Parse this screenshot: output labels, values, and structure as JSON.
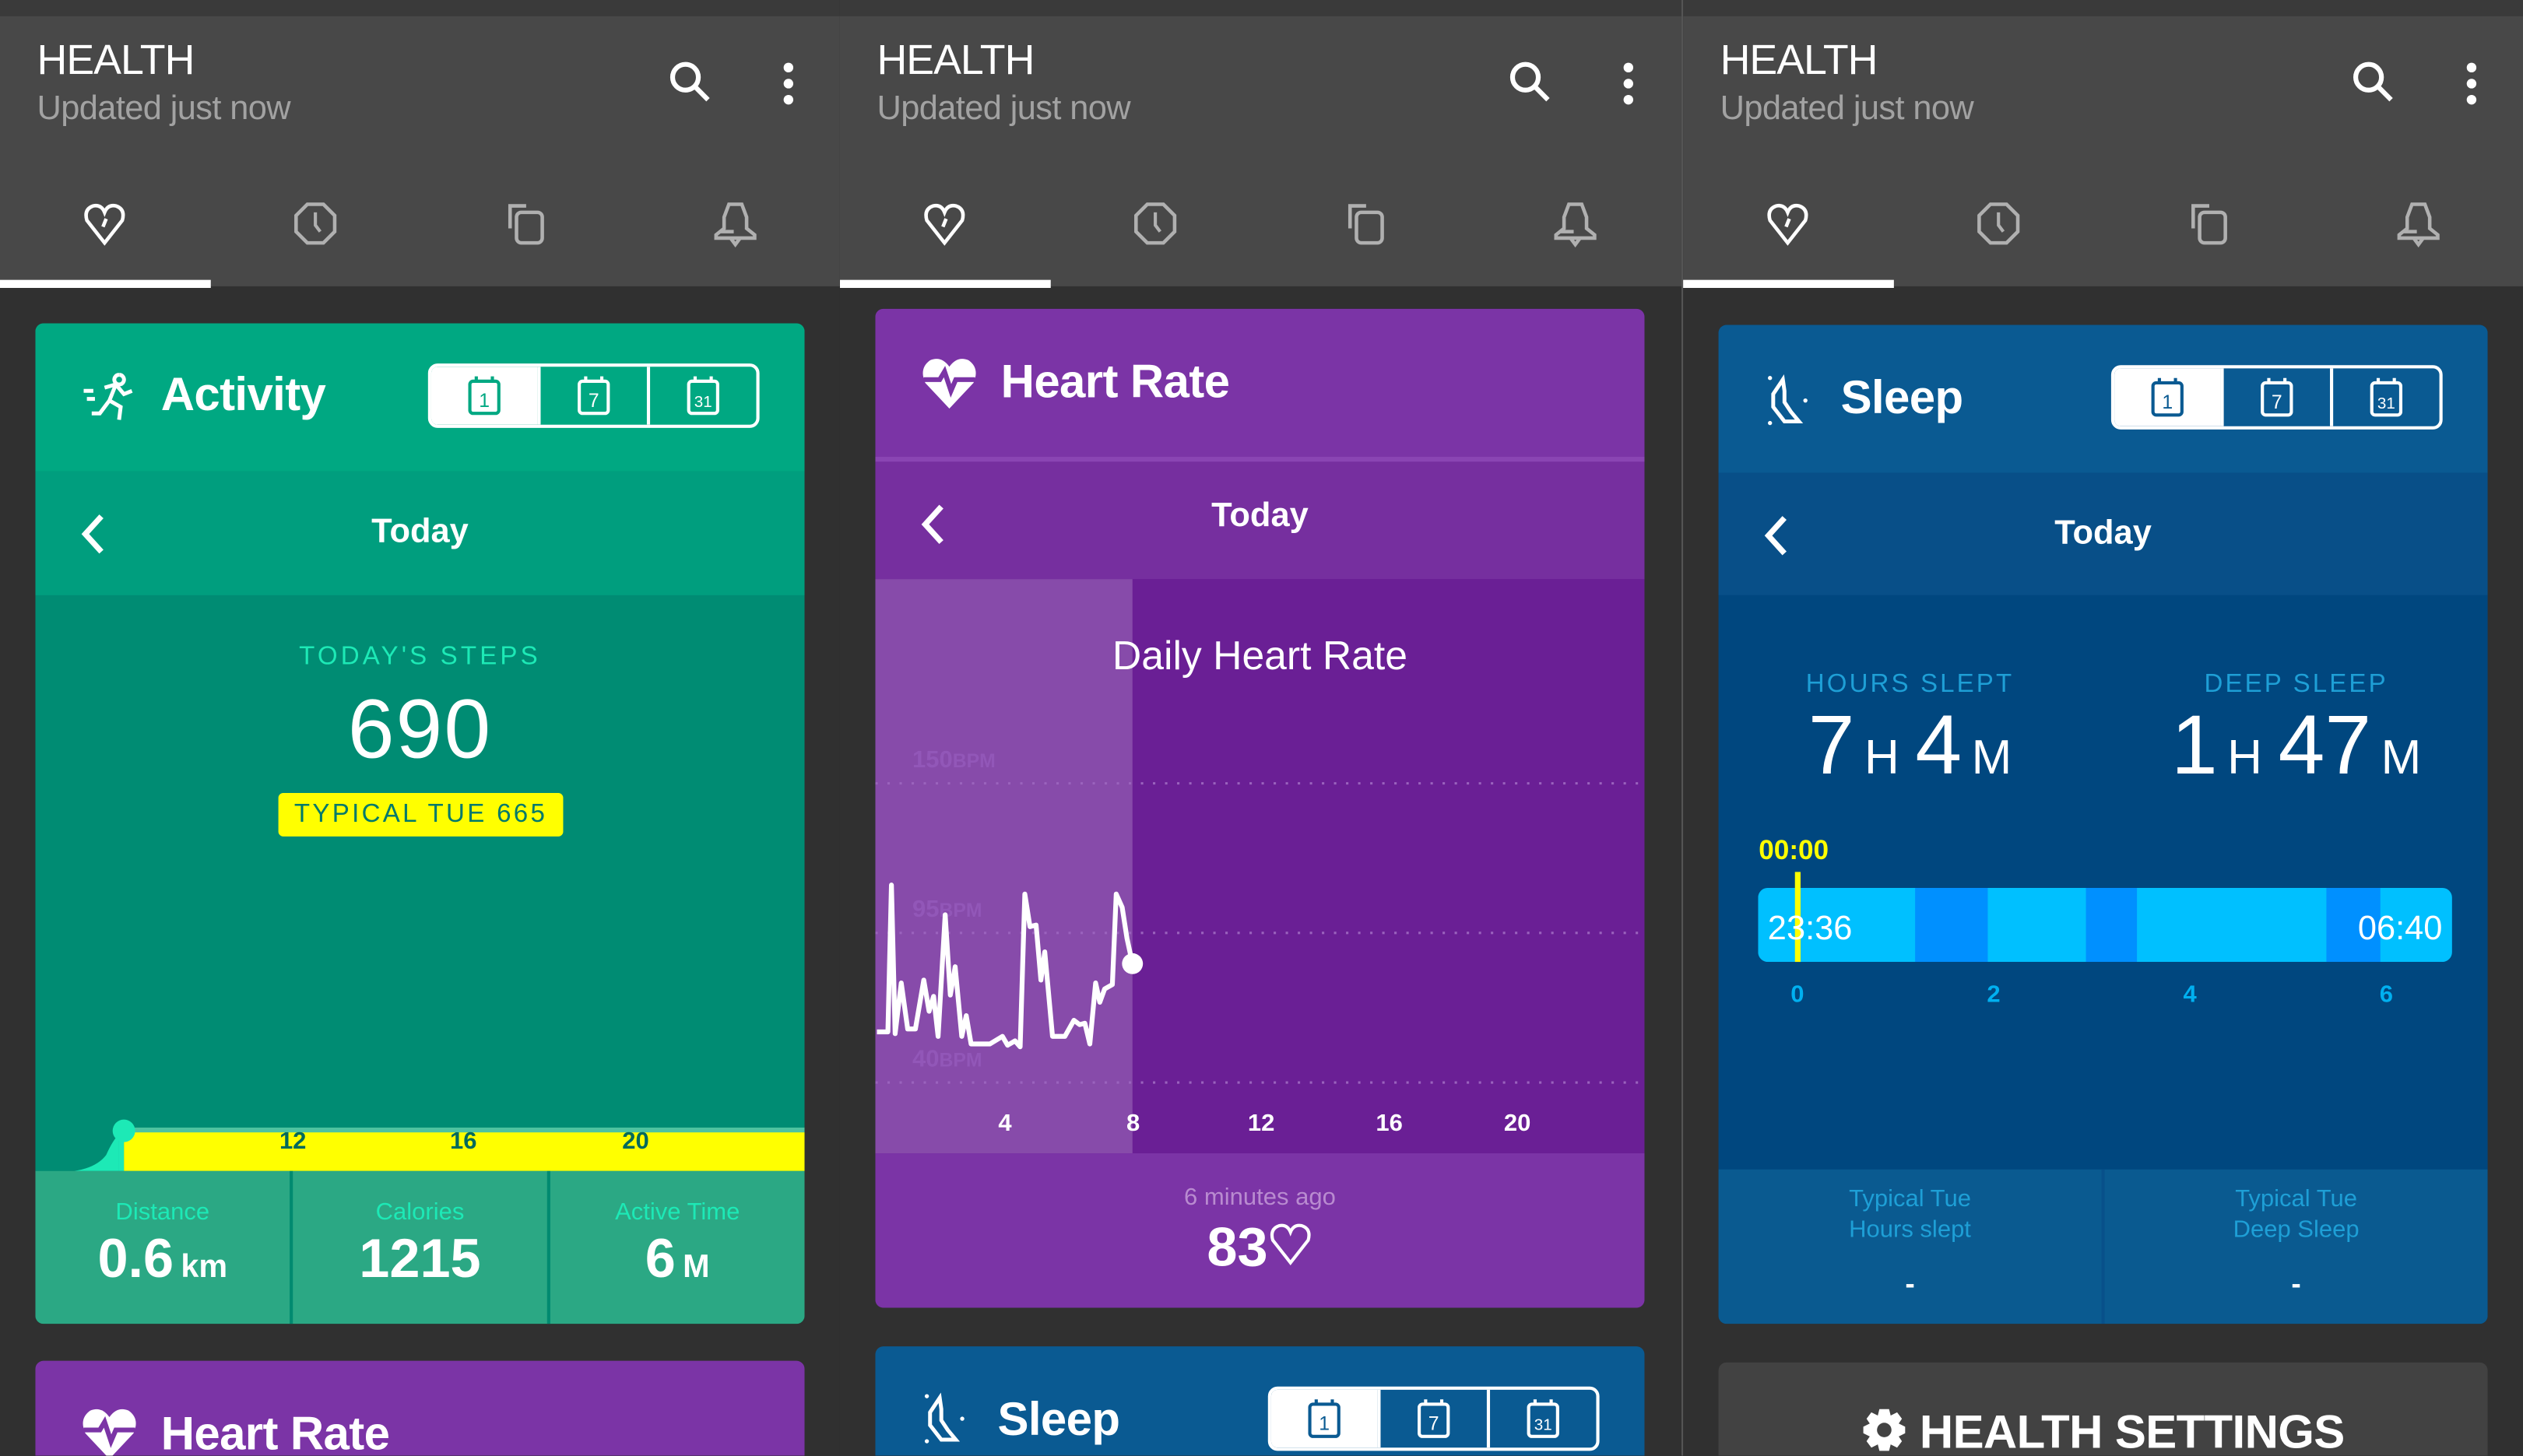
{
  "app": {
    "title": "HEALTH",
    "subtitle": "Updated just now"
  },
  "tabs": [
    {
      "icon": "heart-icon",
      "selected": true
    },
    {
      "icon": "clock-icon",
      "selected": false
    },
    {
      "icon": "copy-icon",
      "selected": false
    },
    {
      "icon": "bell-icon",
      "selected": false
    }
  ],
  "range_toggle": [
    "1",
    "7",
    "31"
  ],
  "colors": {
    "activity_header": "#00a882",
    "activity_body": "#008c73",
    "activity_accent": "#1de9b6",
    "typical_badge": "#ffff00",
    "heart_header": "#7b34a6",
    "heart_chart": "#6a1f95",
    "sleep_header": "#0a5a92",
    "sleep_body": "#00477f",
    "sleep_light": "#00c0ff",
    "sleep_deep": "#0090ff",
    "now_marker": "#ffff00"
  },
  "activity": {
    "title": "Activity",
    "nav_label": "Today",
    "steps_label": "TODAY'S STEPS",
    "steps": "690",
    "typical": "TYPICAL TUE 665",
    "chart_ticks": [
      "12",
      "16",
      "20"
    ],
    "stats": [
      {
        "label": "Distance",
        "value": "0.6",
        "unit": "km"
      },
      {
        "label": "Calories",
        "value": "1215",
        "unit": ""
      },
      {
        "label": "Active Time",
        "value": "6",
        "unit": "M"
      }
    ]
  },
  "heart": {
    "title": "Heart Rate",
    "nav_label": "Today",
    "chart_title": "Daily Heart Rate",
    "updated": "6 minutes ago",
    "current": "83",
    "current_icon": "heart-outline-icon"
  },
  "sleep": {
    "title": "Sleep",
    "nav_label": "Today",
    "hours_label": "HOURS SLEPT",
    "hours_h": "7",
    "hours_m": "4",
    "deep_label": "DEEP SLEEP",
    "deep_h": "1",
    "deep_m": "47",
    "h_unit": "H",
    "m_unit": "M",
    "now_label": "00:00",
    "start_label": "23:36",
    "end_label": "06:40",
    "typical": [
      {
        "line1": "Typical Tue",
        "line2": "Hours slept",
        "value": "-"
      },
      {
        "line1": "Typical Tue",
        "line2": "Deep Sleep",
        "value": "-"
      }
    ]
  },
  "settings": {
    "label": "HEALTH SETTINGS"
  },
  "chart_data": [
    {
      "type": "line",
      "title": "Daily Heart Rate",
      "x_ticks": [
        "4",
        "8",
        "12",
        "16",
        "20"
      ],
      "xlim": [
        0,
        24
      ],
      "y_ticks": [
        {
          "value": 150,
          "label": "150",
          "unit": "BPM"
        },
        {
          "value": 95,
          "label": "95",
          "unit": "BPM"
        },
        {
          "value": 40,
          "label": "40",
          "unit": "BPM"
        }
      ],
      "grid": true,
      "points": [
        [
          0,
          58.6
        ],
        [
          0.34,
          58.6
        ],
        [
          0.45,
          112.6
        ],
        [
          0.57,
          58
        ],
        [
          0.76,
          76.6
        ],
        [
          0.96,
          59.7
        ],
        [
          1.2,
          59.7
        ],
        [
          1.46,
          77.7
        ],
        [
          1.63,
          66.2
        ],
        [
          1.77,
          71.7
        ],
        [
          1.91,
          57
        ],
        [
          2.13,
          101.7
        ],
        [
          2.29,
          72.2
        ],
        [
          2.44,
          82.6
        ],
        [
          2.65,
          57
        ],
        [
          2.79,
          64.6
        ],
        [
          2.94,
          54.2
        ],
        [
          3.53,
          54.2
        ],
        [
          3.92,
          57
        ],
        [
          4.08,
          53.7
        ],
        [
          4.31,
          55.3
        ],
        [
          4.47,
          53.1
        ],
        [
          4.62,
          109.3
        ],
        [
          4.78,
          97.3
        ],
        [
          4.97,
          97.9
        ],
        [
          5.12,
          77.7
        ],
        [
          5.24,
          88
        ],
        [
          5.48,
          57
        ],
        [
          5.87,
          57
        ],
        [
          6.15,
          62.9
        ],
        [
          6.33,
          61.3
        ],
        [
          6.49,
          61.8
        ],
        [
          6.65,
          54.2
        ],
        [
          6.83,
          76.6
        ],
        [
          6.96,
          69.5
        ],
        [
          7.11,
          74.4
        ],
        [
          7.35,
          76
        ],
        [
          7.47,
          109.3
        ],
        [
          7.66,
          104.4
        ],
        [
          7.81,
          93
        ],
        [
          7.98,
          83.7
        ]
      ]
    },
    {
      "type": "bar",
      "x_ticks": [
        "0",
        "2",
        "4",
        "6"
      ],
      "start": "23:36",
      "end": "06:40",
      "now": "00:00",
      "segments": [
        {
          "from": -0.4,
          "to": 1.2,
          "stage": "light"
        },
        {
          "from": 1.2,
          "to": 1.94,
          "stage": "deep"
        },
        {
          "from": 1.94,
          "to": 2.94,
          "stage": "light"
        },
        {
          "from": 2.94,
          "to": 3.46,
          "stage": "deep"
        },
        {
          "from": 3.46,
          "to": 5.39,
          "stage": "light"
        },
        {
          "from": 5.39,
          "to": 5.94,
          "stage": "deep"
        },
        {
          "from": 5.94,
          "to": 6.67,
          "stage": "light"
        }
      ]
    }
  ]
}
